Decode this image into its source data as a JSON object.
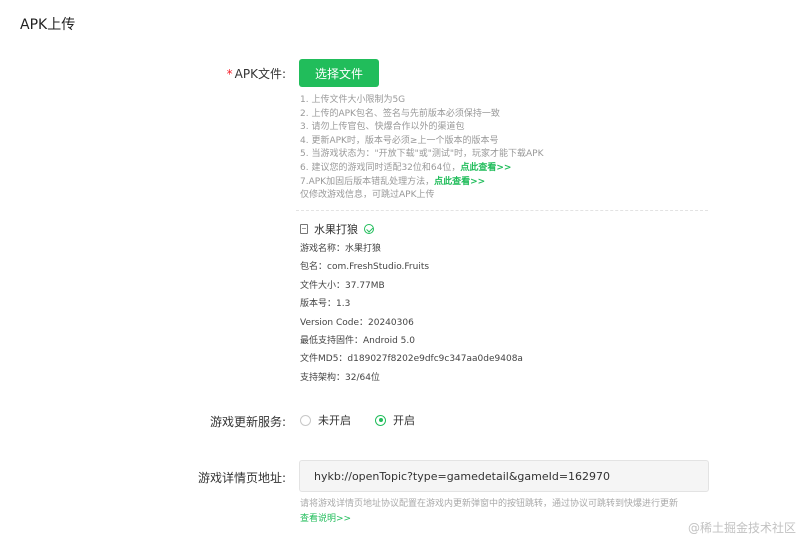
{
  "section_title": "APK上传",
  "apk": {
    "label": "APK文件:",
    "required_mark": "*",
    "select_button": "选择文件",
    "tips": [
      "1. 上传文件大小限制为5G",
      "2. 上传的APK包名、签名与先前版本必须保持一致",
      "3. 请勿上传官包、快爆合作以外的渠道包",
      "4. 更新APK时，版本号必须≥上一个版本的版本号",
      "5. 当游戏状态为：\"开放下载\"或\"测试\"时，玩家才能下载APK"
    ],
    "tip6_text": "6. 建议您的游戏同时适配32位和64位，",
    "tip6_link": "点此查看>>",
    "tip7_text": "7.APK加固后版本错乱处理方法，",
    "tip7_link": "点此查看>>",
    "tip8": "仅修改游戏信息，可跳过APK上传"
  },
  "app_info": {
    "name": "水果打狼",
    "rows": [
      "游戏名称：水果打狼",
      "包名：com.FreshStudio.Fruits",
      "文件大小：37.77MB",
      "版本号：1.3",
      "Version Code：20240306",
      "最低支持固件：Android 5.0",
      "文件MD5：d189027f8202e9dfc9c347aa0de9408a",
      "支持架构：32/64位"
    ]
  },
  "update_service": {
    "label": "游戏更新服务:",
    "options": [
      "未开启",
      "开启"
    ],
    "selected": "开启"
  },
  "detail_url": {
    "label": "游戏详情页地址:",
    "value": "hykb://openTopic?type=gamedetail&gameId=162970",
    "help": "请将游戏详情页地址协议配置在游戏内更新弹窗中的按钮跳转，通过协议可跳转到快爆进行更新",
    "help_link": "查看说明>>"
  },
  "watermark": "@稀土掘金技术社区",
  "colors": {
    "accent": "#21bd5b",
    "required": "#f5222d"
  }
}
